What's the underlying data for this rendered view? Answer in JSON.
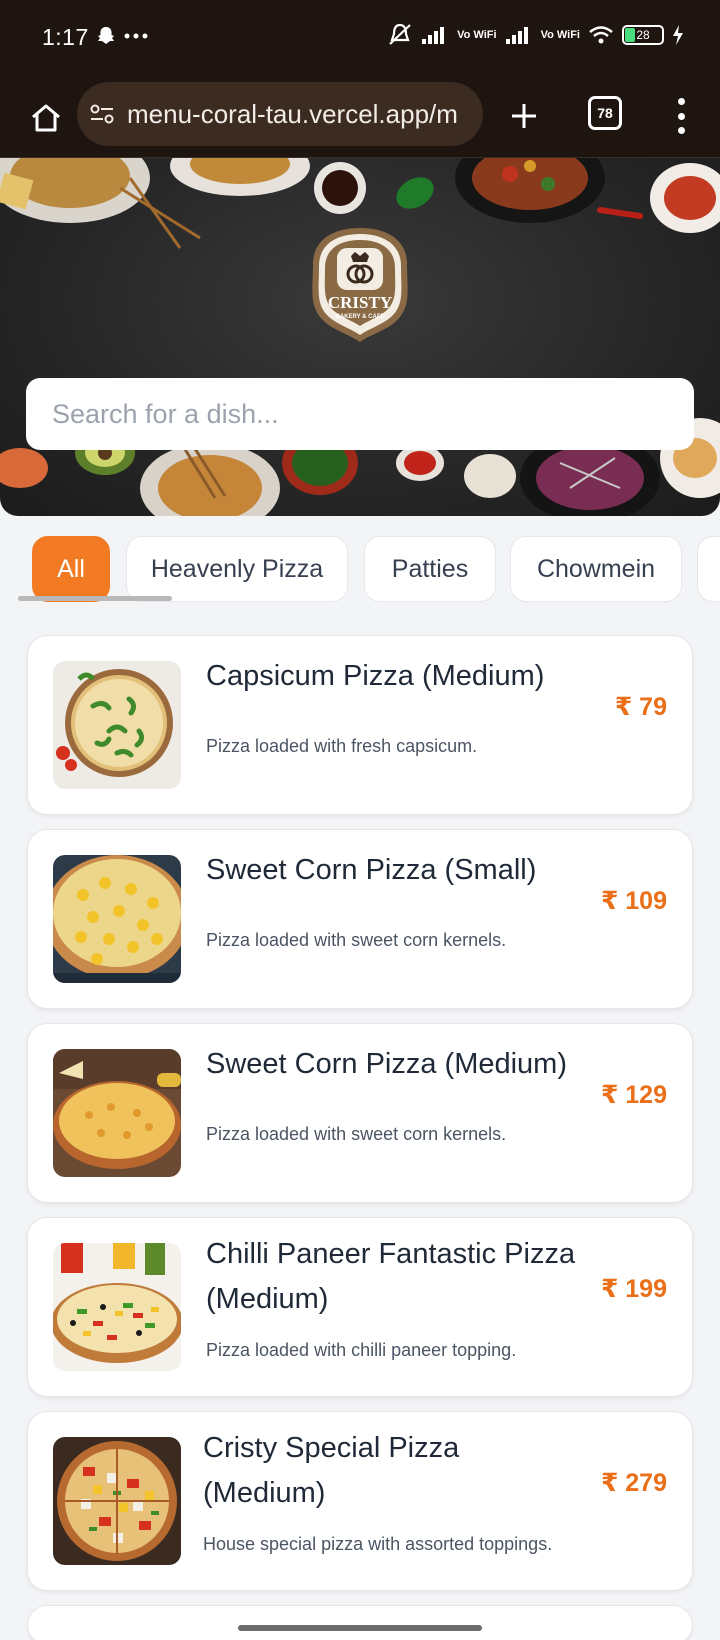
{
  "status": {
    "time": "1:17",
    "battery": "28",
    "vowifi": "Vo WiFi"
  },
  "browser": {
    "url": "menu-coral-tau.vercel.app/m",
    "tab_count": "78"
  },
  "search": {
    "placeholder": "Search for a dish..."
  },
  "categories": [
    "All",
    "Heavenly Pizza",
    "Patties",
    "Chowmein"
  ],
  "logo": {
    "name": "CRISTY",
    "tagline": "BAKERY & CAFE"
  },
  "items": [
    {
      "name": "Capsicum Pizza (Medium)",
      "desc": "Pizza loaded with fresh capsicum.",
      "price": "₹ 79"
    },
    {
      "name": "Sweet Corn Pizza (Small)",
      "desc": "Pizza loaded with sweet corn kernels.",
      "price": "₹ 109"
    },
    {
      "name": "Sweet Corn Pizza (Medium)",
      "desc": "Pizza loaded with sweet corn kernels.",
      "price": "₹ 129"
    },
    {
      "name": "Chilli Paneer Fantastic Pizza (Medium)",
      "desc": "Pizza loaded with chilli paneer topping.",
      "price": "₹ 199"
    },
    {
      "name": "Cristy Special Pizza (Medium)",
      "desc": "House special pizza with assorted toppings.",
      "price": "₹ 279"
    }
  ],
  "colors": {
    "accent": "#f27a22",
    "price": "#ea6f18",
    "chrome": "#1e1510"
  }
}
